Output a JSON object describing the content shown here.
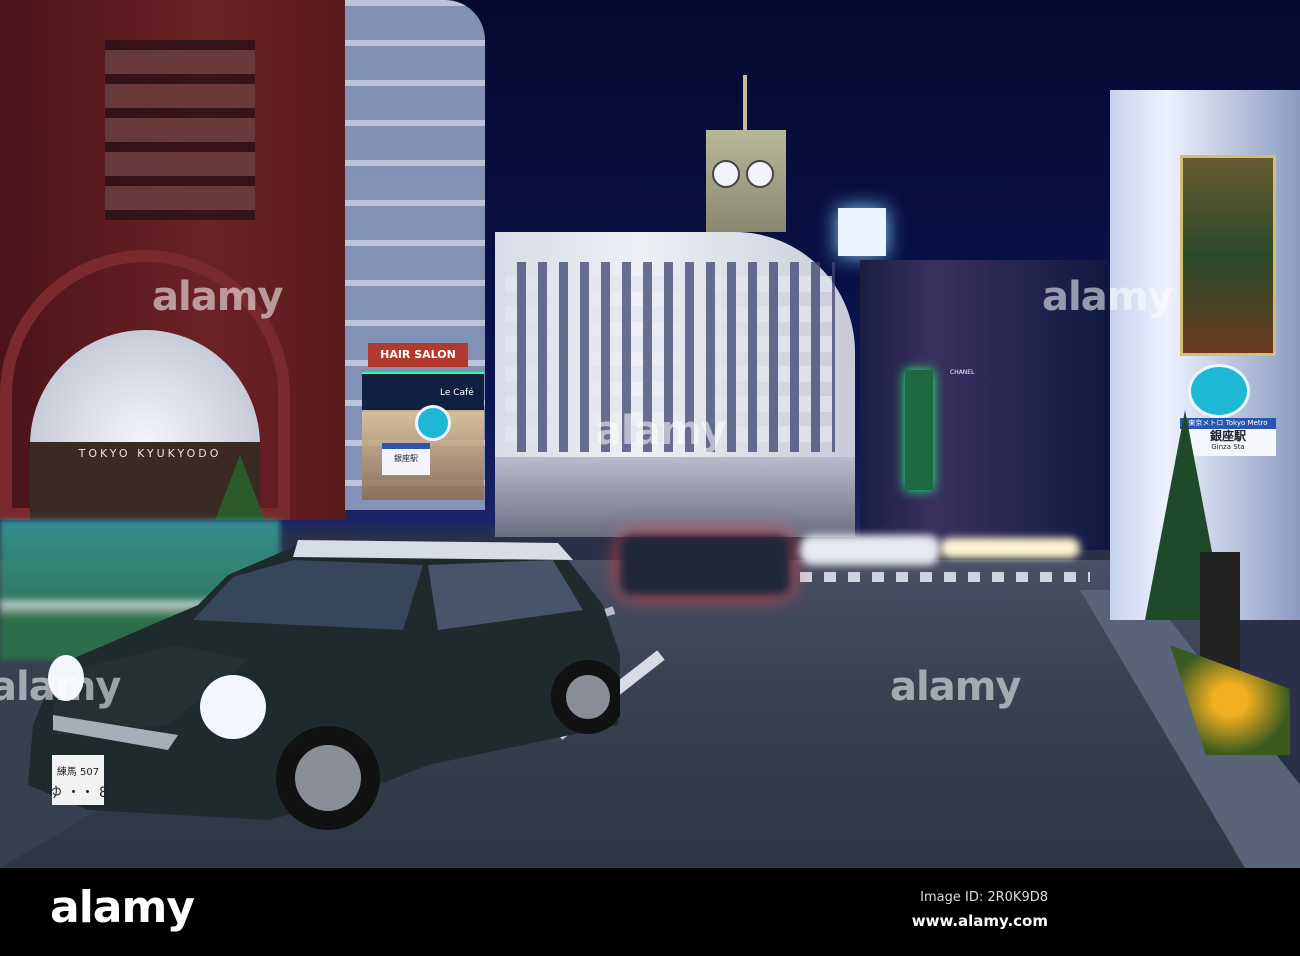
{
  "scene": {
    "signs": {
      "shop_name": "TOKYO  KYUKYODO",
      "hair_salon": "HAIR SALON",
      "cafe": "Le Café",
      "chanel": "CHANEL",
      "station_operator": "東京メトロ Tokyo Metro",
      "station_name": "銀座駅",
      "station_name_en": "Ginza Sta",
      "left_station_sign": "銀座駅"
    },
    "license_plate": {
      "line1": "練馬 507",
      "line2": "ゆ ・・ 8"
    }
  },
  "watermark": "alamy",
  "footer": {
    "logo": "alamy",
    "image_id": "Image ID: 2R0K9D8",
    "website": "www.alamy.com"
  },
  "colors": {
    "sky": "#0a1450",
    "metro_sign": "#1eb8d6",
    "footer_bg": "#000000"
  }
}
